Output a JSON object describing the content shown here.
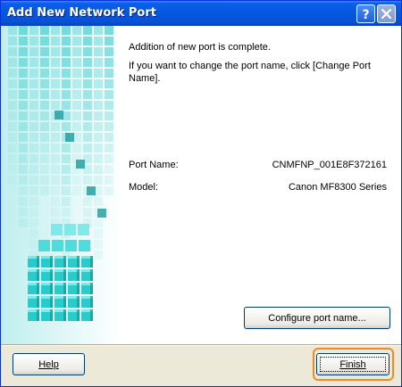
{
  "window": {
    "title": "Add New Network Port",
    "help_button_label": "?",
    "close_button_label": "✕"
  },
  "message": {
    "line1": "Addition of new port is complete.",
    "line2": "If you want to change the port name, click [Change Port Name]."
  },
  "details": {
    "port_name_label": "Port Name:",
    "port_name_value": "CNMFNP_001E8F372161",
    "model_label": "Model:",
    "model_value": "Canon MF8300 Series"
  },
  "buttons": {
    "configure": "Configure port name...",
    "help": "Help",
    "finish": "Finish"
  },
  "colors": {
    "titlebar": "#0457e0",
    "art_teal": "#1fc8c8",
    "focus_ring": "#f08a24"
  }
}
